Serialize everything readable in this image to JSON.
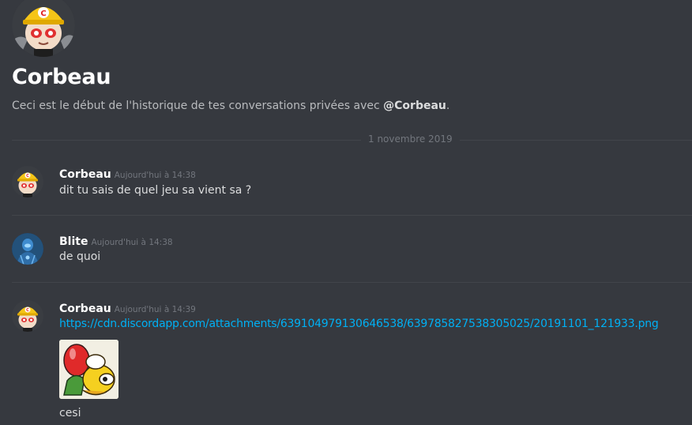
{
  "channel": {
    "name": "Corbeau",
    "intro_prefix": "Ceci est le début de l'historique de tes conversations privées avec ",
    "intro_mention": "@Corbeau",
    "intro_suffix": "."
  },
  "divider": {
    "date": "1 novembre 2019"
  },
  "messages": [
    {
      "author": "Corbeau",
      "timestamp": "Aujourd'hui à 14:38",
      "text": "dit tu sais de quel jeu sa vient sa ?",
      "avatar": "inkling-yellow-helmet-avatar"
    },
    {
      "author": "Blite",
      "timestamp": "Aujourd'hui à 14:38",
      "text": "de quoi",
      "avatar": "blue-armor-avatar"
    },
    {
      "author": "Corbeau",
      "timestamp": "Aujourd'hui à 14:39",
      "link": "https://cdn.discordapp.com/attachments/639104979130646538/639785827538305025/20191101_121933.png",
      "text": "cesi",
      "avatar": "inkling-yellow-helmet-avatar"
    }
  ],
  "colors": {
    "background": "#36393f",
    "link": "#00b0f4",
    "muted": "#72767d",
    "text": "#dcddde"
  }
}
